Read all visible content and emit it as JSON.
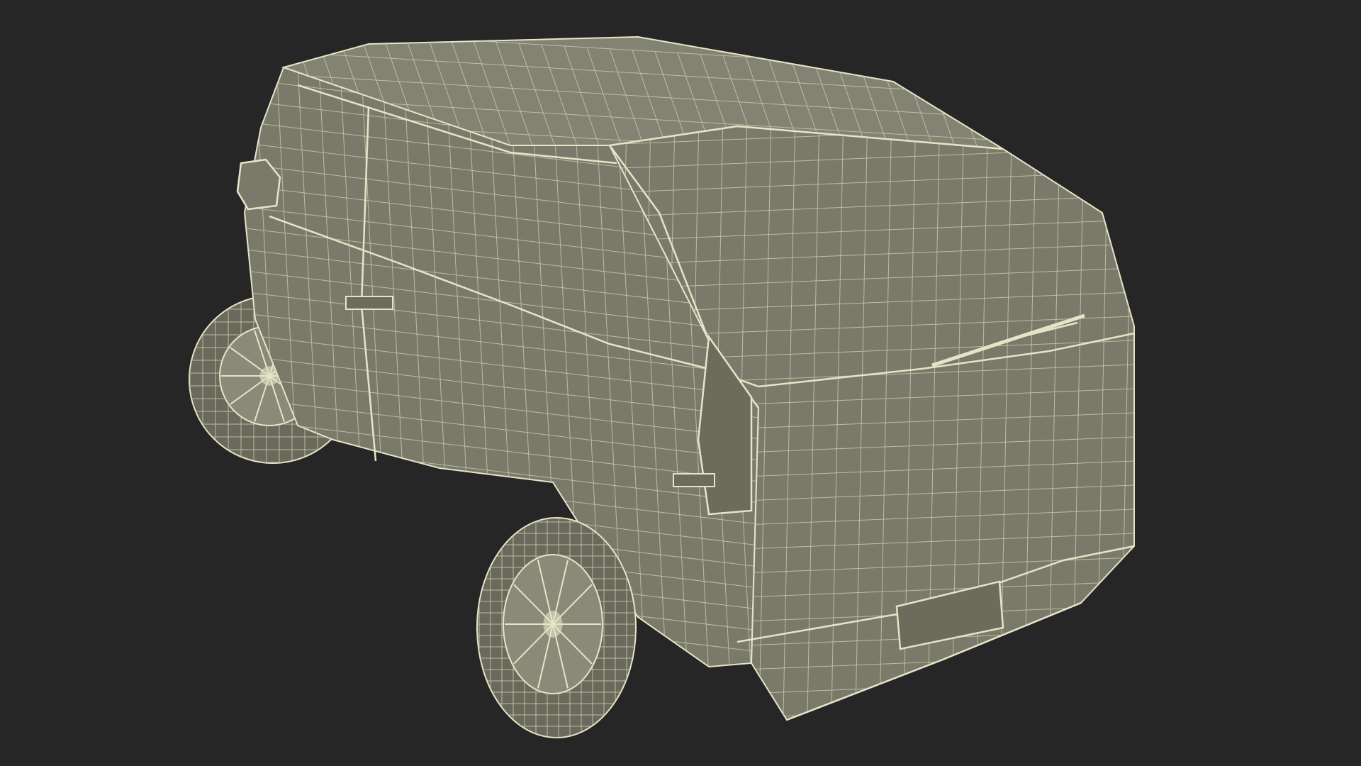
{
  "render": {
    "subject": "wireframe-van-rear-three-quarter",
    "colors": {
      "background": "#262626",
      "body_fill": "#7a7a6a",
      "body_shade": "#6c6c5d",
      "panel_fill": "#838373",
      "wire": "#e6e4c8",
      "wire_dim": "#c9c7ac",
      "tire_fill": "#6a6a5c",
      "rim_fill": "#8a8a78"
    }
  }
}
